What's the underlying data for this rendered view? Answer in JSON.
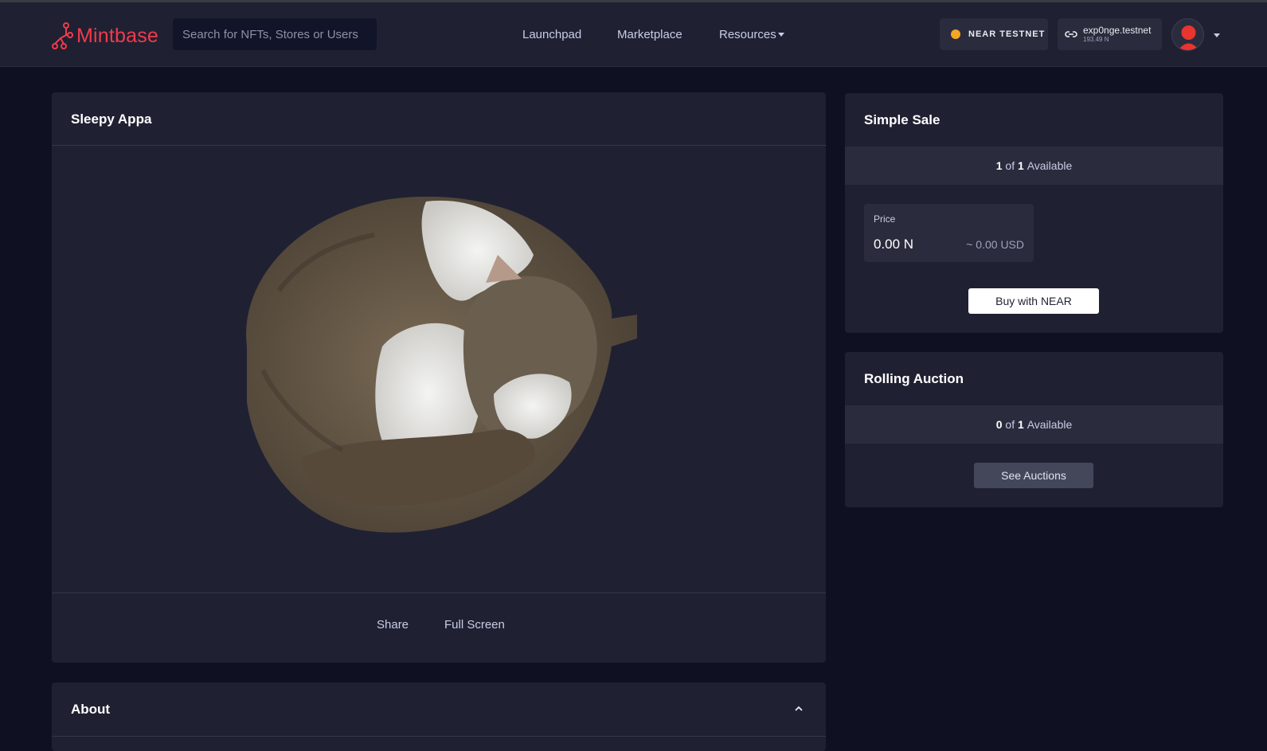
{
  "header": {
    "logo_text": "Mintbase",
    "search_placeholder": "Search for NFTs, Stores or Users",
    "nav": [
      "Launchpad",
      "Marketplace",
      "Resources"
    ],
    "network_label": "NEAR TESTNET",
    "wallet_name": "exp0nge.testnet",
    "wallet_balance": "193.49 N"
  },
  "nft": {
    "title": "Sleepy Appa",
    "actions": [
      "Share",
      "Full Screen"
    ]
  },
  "simple_sale": {
    "title": "Simple Sale",
    "available": "1",
    "total": "1",
    "of_text": "of",
    "available_text": "Available",
    "price_label": "Price",
    "price_near": "0.00 N",
    "price_usd": "~ 0.00 USD",
    "buy_label": "Buy with NEAR"
  },
  "rolling_auction": {
    "title": "Rolling Auction",
    "available": "0",
    "total": "1",
    "of_text": "of",
    "available_text": "Available",
    "button_label": "See Auctions"
  },
  "about": {
    "title": "About"
  },
  "colors": {
    "background": "#0f1123",
    "panel": "#1f2132",
    "brand": "#f23a4c",
    "network_dot": "#f5a623"
  },
  "icons": [
    "mintbase-logo-icon",
    "chevron-down-icon",
    "link-icon",
    "avatar-icon",
    "chevron-up-icon"
  ]
}
